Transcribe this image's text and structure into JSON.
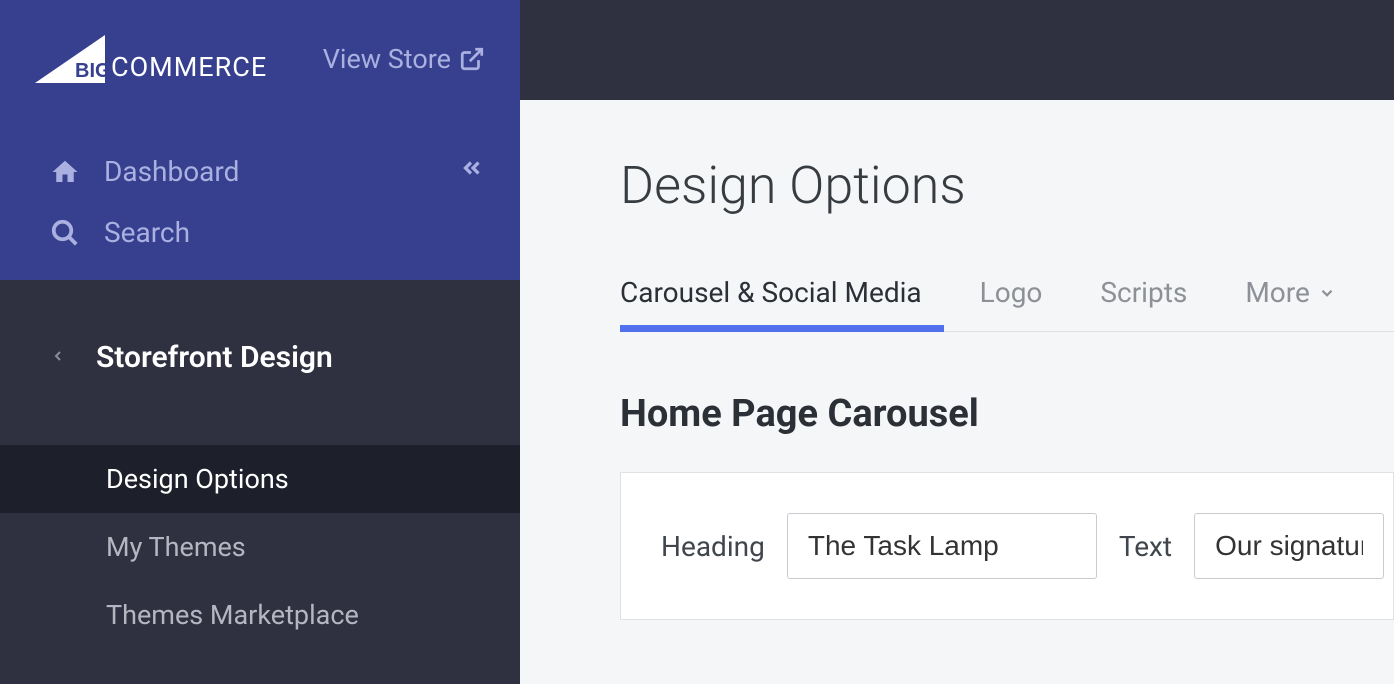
{
  "header": {
    "logo_big": "BIG",
    "logo_commerce": "COMMERCE",
    "view_store": "View Store"
  },
  "sidebar": {
    "dashboard": "Dashboard",
    "search": "Search",
    "section_title": "Storefront Design",
    "items": [
      {
        "label": "Design Options",
        "active": true
      },
      {
        "label": "My Themes",
        "active": false
      },
      {
        "label": "Themes Marketplace",
        "active": false
      }
    ]
  },
  "main": {
    "page_title": "Design Options",
    "tabs": [
      {
        "label": "Carousel & Social Media",
        "active": true
      },
      {
        "label": "Logo",
        "active": false
      },
      {
        "label": "Scripts",
        "active": false
      },
      {
        "label": "More",
        "active": false,
        "dropdown": true
      }
    ],
    "section": {
      "title": "Home Page Carousel",
      "fields": {
        "heading_label": "Heading",
        "heading_value": "The Task Lamp",
        "text_label": "Text",
        "text_value": "Our signature fi"
      }
    }
  }
}
